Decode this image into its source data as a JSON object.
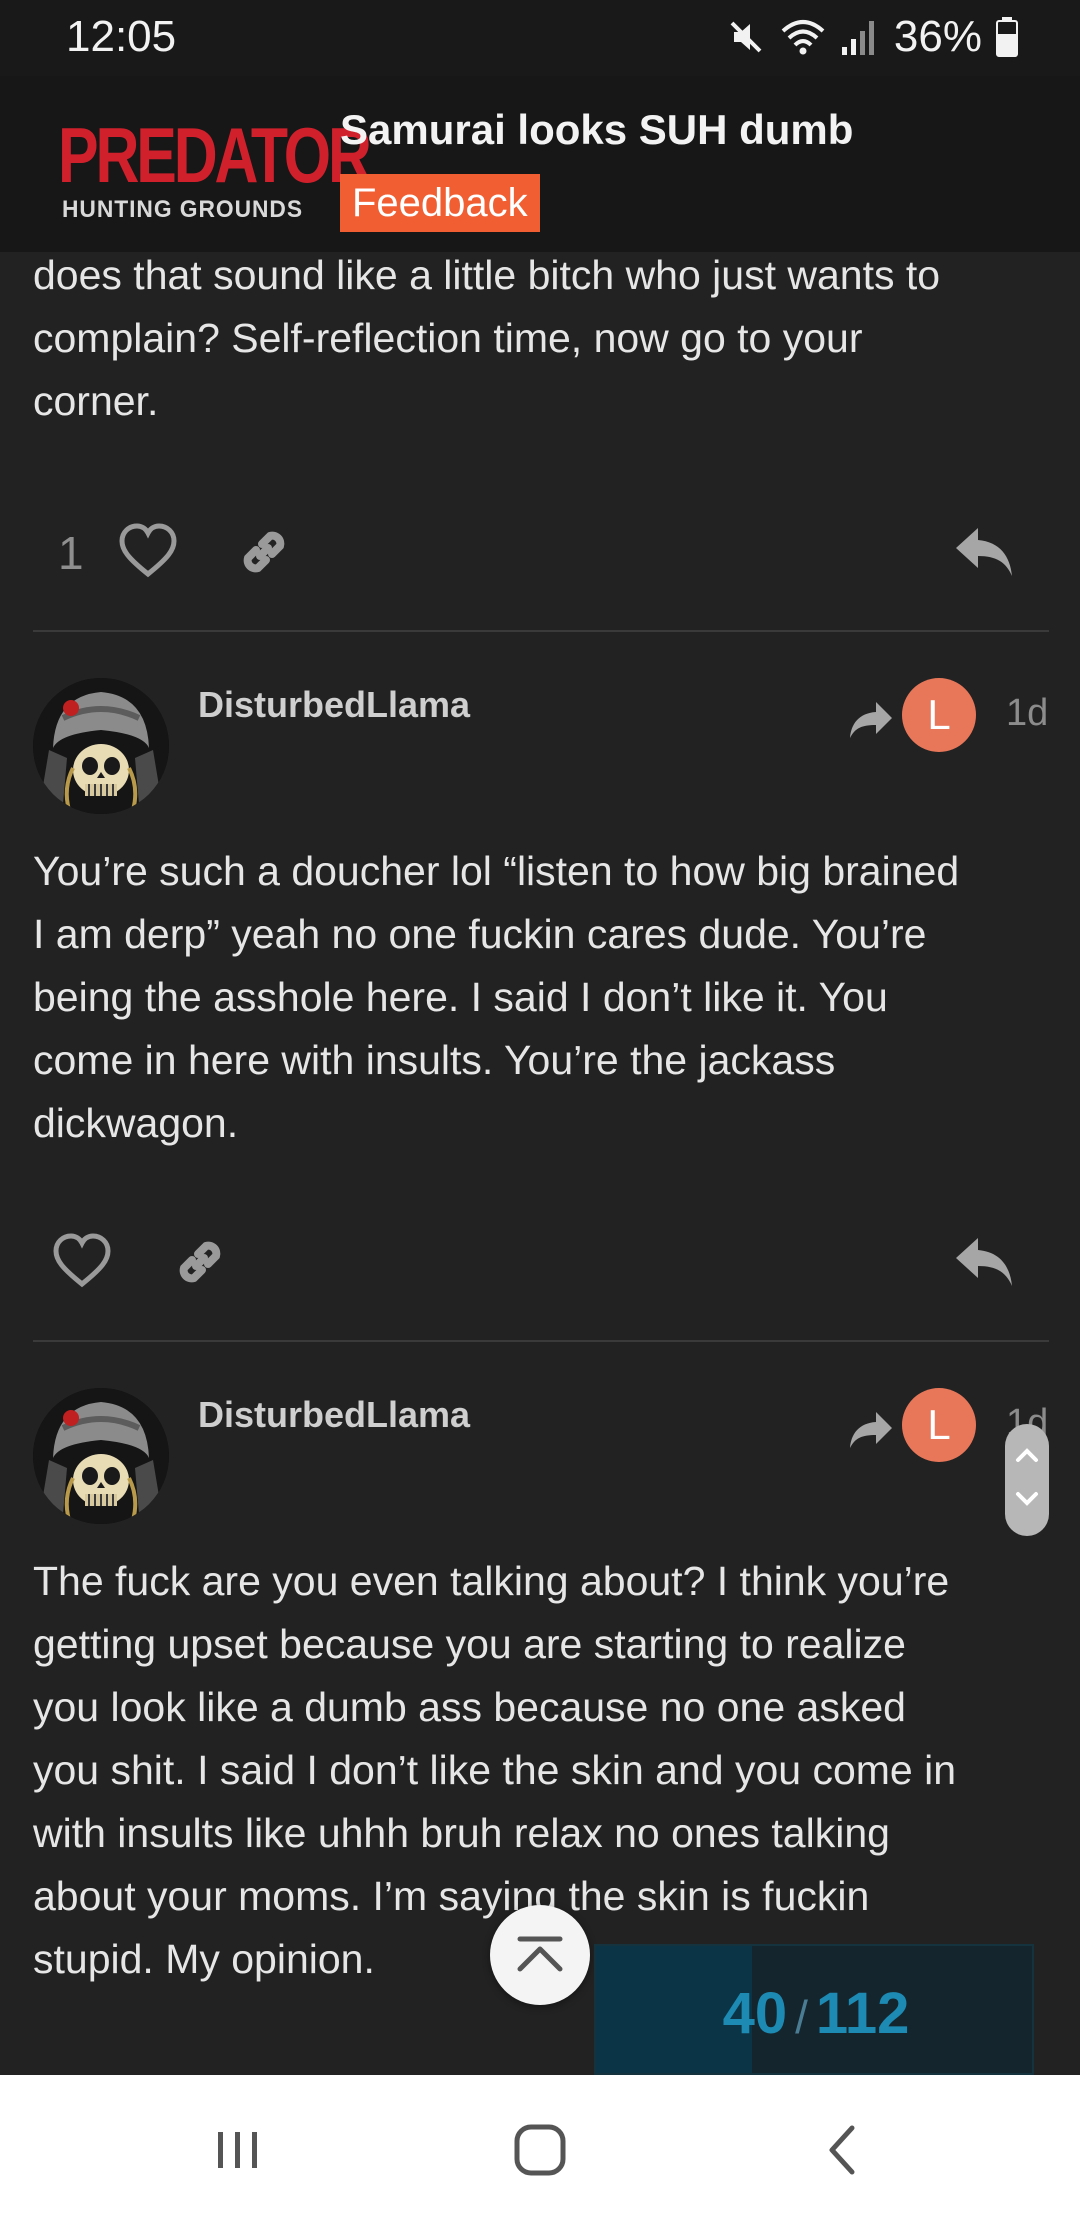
{
  "status_bar": {
    "time": "12:05",
    "battery": "36%",
    "icons": [
      "mute-icon",
      "wifi-icon",
      "signal-icon",
      "battery-icon"
    ]
  },
  "header": {
    "logo_main": "PREDATOR",
    "logo_sub": "HUNTING GROUNDS",
    "topic_title": "Samurai looks SUH dumb",
    "category": "Feedback",
    "category_color": "#f05e32"
  },
  "posts": [
    {
      "text": "does that sound like a little bitch who just wants to\ncomplain? Self-reflection time, now go to your\ncorner.",
      "like_count": "1"
    },
    {
      "username": "DisturbedLlama",
      "reply_to_initial": "L",
      "date": "1d",
      "text": "You’re such a doucher lol “listen to how big brained\nI am derp” yeah no one fuckin cares dude. You’re\nbeing the asshole here. I said I don’t like it. You\ncome in here with insults. You’re the jackass\ndickwagon."
    },
    {
      "username": "DisturbedLlama",
      "reply_to_initial": "L",
      "date": "1d",
      "text": "The fuck are you even talking about? I think you’re\ngetting upset because you are starting to realize\nyou look like a dumb ass because no one asked\nyou shit. I said I don’t like the skin and you come in\nwith insults like uhhh bruh relax no ones talking\nabout your moms. I’m saying the skin is fuckin\nstupid. My opinion."
    }
  ],
  "progress": {
    "current": "40",
    "separator": "/",
    "total": "112",
    "fraction": 0.357
  },
  "colors": {
    "background": "#222222",
    "accent": "#1d8ab3",
    "reply_avatar": "#e8775a"
  }
}
